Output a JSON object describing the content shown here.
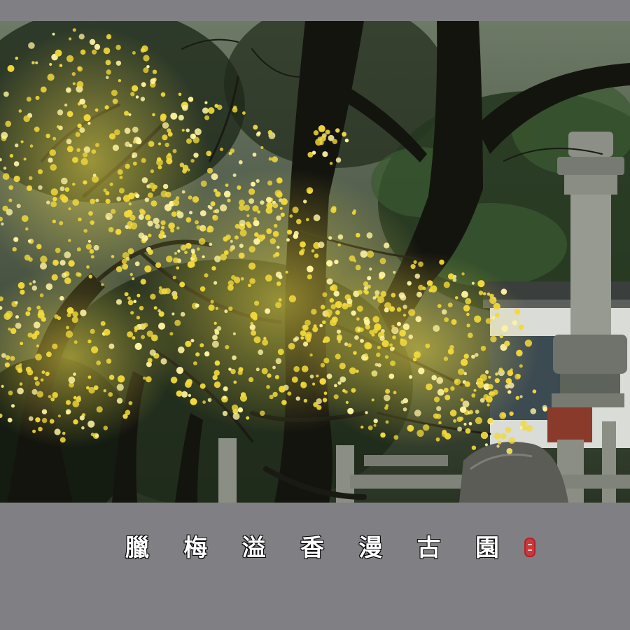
{
  "caption": {
    "title_chars": [
      "臘",
      "梅",
      "溢",
      "香",
      "漫",
      "古",
      "園"
    ]
  },
  "colors": {
    "frame_gray": "#808084",
    "blossom_yellow": "#f2d83a",
    "foliage_dark": "#1c2418",
    "seal_red": "#c83a3a"
  }
}
